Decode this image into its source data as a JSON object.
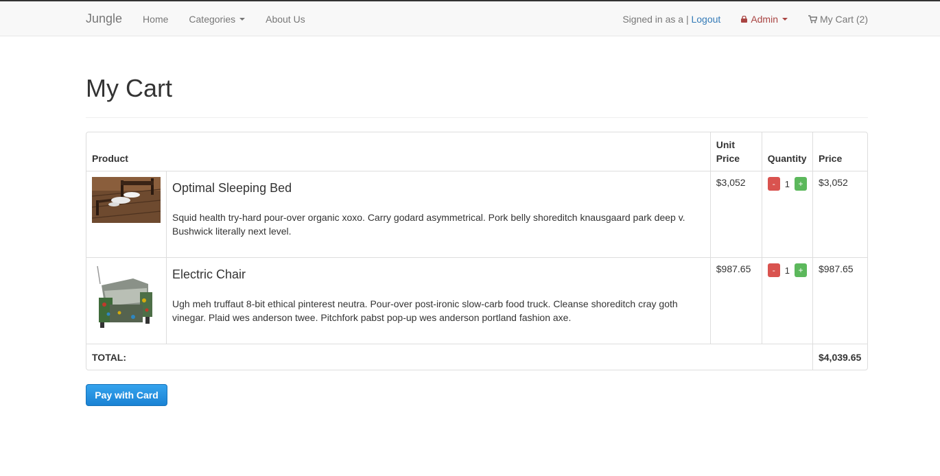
{
  "nav": {
    "brand": "Jungle",
    "links": [
      "Home",
      "Categories",
      "About Us"
    ],
    "signed_text": "Signed in as a |",
    "logout": "Logout",
    "admin": "Admin",
    "cart": "My Cart (2)"
  },
  "page": {
    "title": "My Cart"
  },
  "table": {
    "headers": {
      "product": "Product",
      "unit_price": "Unit Price",
      "quantity": "Quantity",
      "price": "Price"
    },
    "items": [
      {
        "name": "Optimal Sleeping Bed",
        "description": "Squid health try-hard pour-over organic xoxo. Carry godard asymmetrical. Pork belly shoreditch knausgaard park deep v. Bushwick literally next level.",
        "unit_price": "$3,052",
        "quantity": "1",
        "price": "$3,052",
        "image": "bed-photo"
      },
      {
        "name": "Electric Chair",
        "description": "Ugh meh truffaut 8-bit ethical pinterest neutra. Pour-over post-ironic slow-carb food truck. Cleanse shoreditch cray goth vinegar. Plaid wes anderson twee. Pitchfork pabst pop-up wes anderson portland fashion axe.",
        "unit_price": "$987.65",
        "quantity": "1",
        "price": "$987.65",
        "image": "chair-photo"
      }
    ],
    "qty_minus": "-",
    "qty_plus": "+",
    "total_label": "TOTAL:",
    "total_value": "$4,039.65"
  },
  "pay_button": "Pay with Card",
  "colors": {
    "link": "#337ab7",
    "admin": "#a94442",
    "minus": "#d9534f",
    "plus": "#5cb85c",
    "pay": "#1a82d4"
  }
}
